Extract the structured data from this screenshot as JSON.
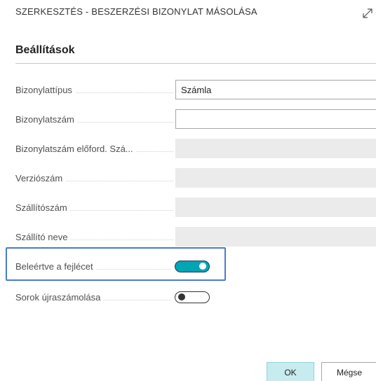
{
  "dialog": {
    "title": "SZERKESZTÉS - BESZERZÉSI BIZONYLAT MÁSOLÁSA",
    "expand_icon": "expand-diagonal-icon"
  },
  "section": {
    "heading": "Beállítások"
  },
  "fields": {
    "doc_type": {
      "label": "Bizonylattípus",
      "value": "Számla",
      "icon": "chevron-down-icon"
    },
    "doc_no": {
      "label": "Bizonylatszám",
      "value": "",
      "icon_text": "..."
    },
    "doc_no_hist": {
      "label": "Bizonylatszám előford. Szá..."
    },
    "version_no": {
      "label": "Verziószám"
    },
    "vendor_no": {
      "label": "Szállítószám"
    },
    "vendor_name": {
      "label": "Szállító neve"
    },
    "include_header": {
      "label": "Beleértve a fejlécet",
      "enabled": true
    },
    "recalc_lines": {
      "label": "Sorok újraszámolása",
      "enabled": false
    }
  },
  "buttons": {
    "ok": "OK",
    "cancel": "Mégse"
  },
  "colors": {
    "toggle_on": "#00a5b3",
    "highlight": "#4a7bc8",
    "ok_button": "#c7ecef"
  }
}
